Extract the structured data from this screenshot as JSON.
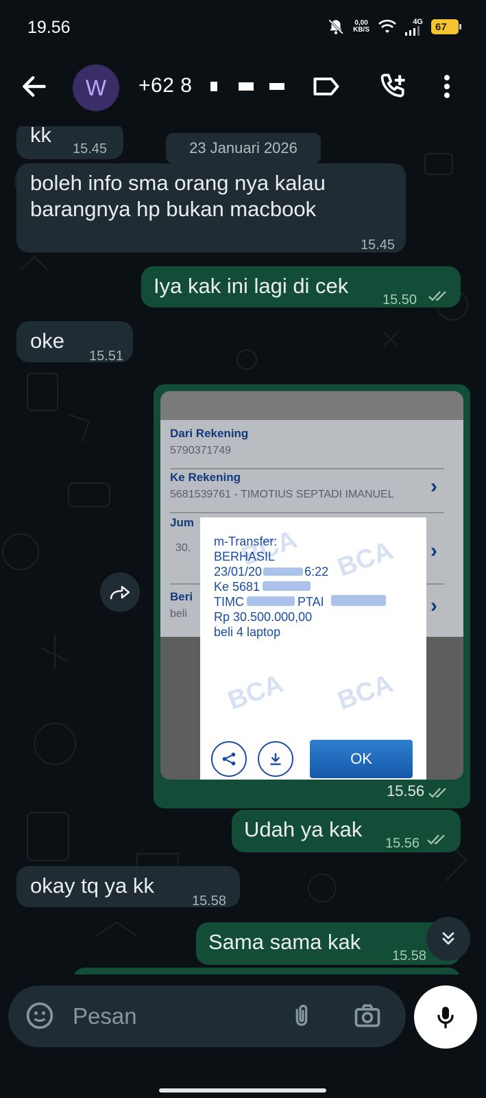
{
  "status_bar": {
    "time": "19.56",
    "net_speed_value": "0,00",
    "net_speed_unit": "KB/S",
    "network": "4G",
    "battery": "67"
  },
  "header": {
    "avatar_letter": "W",
    "contact_prefix": "+62 8"
  },
  "date_chip": "23 Januari 2026",
  "messages": [
    {
      "text": "kk",
      "time": "15.45"
    },
    {
      "text": "boleh info sma orang nya kalau barangnya hp bukan macbook",
      "time": "15.45"
    },
    {
      "text": "Iya kak ini lagi di cek",
      "time": "15.50"
    },
    {
      "text": "oke",
      "time": "15.51"
    },
    {
      "text": "Udah ya kak",
      "time": "15.56"
    },
    {
      "text": "okay tq ya kk",
      "time": "15.58"
    },
    {
      "text": "Sama sama kak",
      "time": "15.58"
    }
  ],
  "image_message": {
    "time": "15.56",
    "screenshot": {
      "from_label": "Dari Rekening",
      "from_value": "5790371749",
      "to_label": "Ke Rekening",
      "to_value": "5681539761 - TIMOTIUS SEPTADI IMANUEL",
      "amount_label_partial": "Jum",
      "amount_value_partial": "30.",
      "note_label_partial": "Beri",
      "note_value_partial": "beli",
      "dialog_lines": [
        "m-Transfer:",
        "BERHASIL",
        "23/01/20",
        "6:22",
        "Ke 5681",
        "TIMC",
        "PTAI",
        "Rp 30.500.000,00",
        "beli 4 laptop"
      ],
      "watermark": "BCA",
      "ok_label": "OK"
    }
  },
  "input": {
    "placeholder": "Pesan"
  },
  "icons": [
    "back-arrow-icon",
    "label-icon",
    "add-call-icon",
    "more-vert-icon",
    "forward-icon",
    "double-chevron-down-icon",
    "sticker-icon",
    "attach-icon",
    "camera-icon",
    "mic-icon",
    "share-icon",
    "download-icon",
    "double-check-icon"
  ],
  "colors": {
    "background": "#0b1014",
    "incoming_bubble": "#1f2c34",
    "outgoing_bubble": "#144d37",
    "bca_blue": "#1a4da0"
  }
}
